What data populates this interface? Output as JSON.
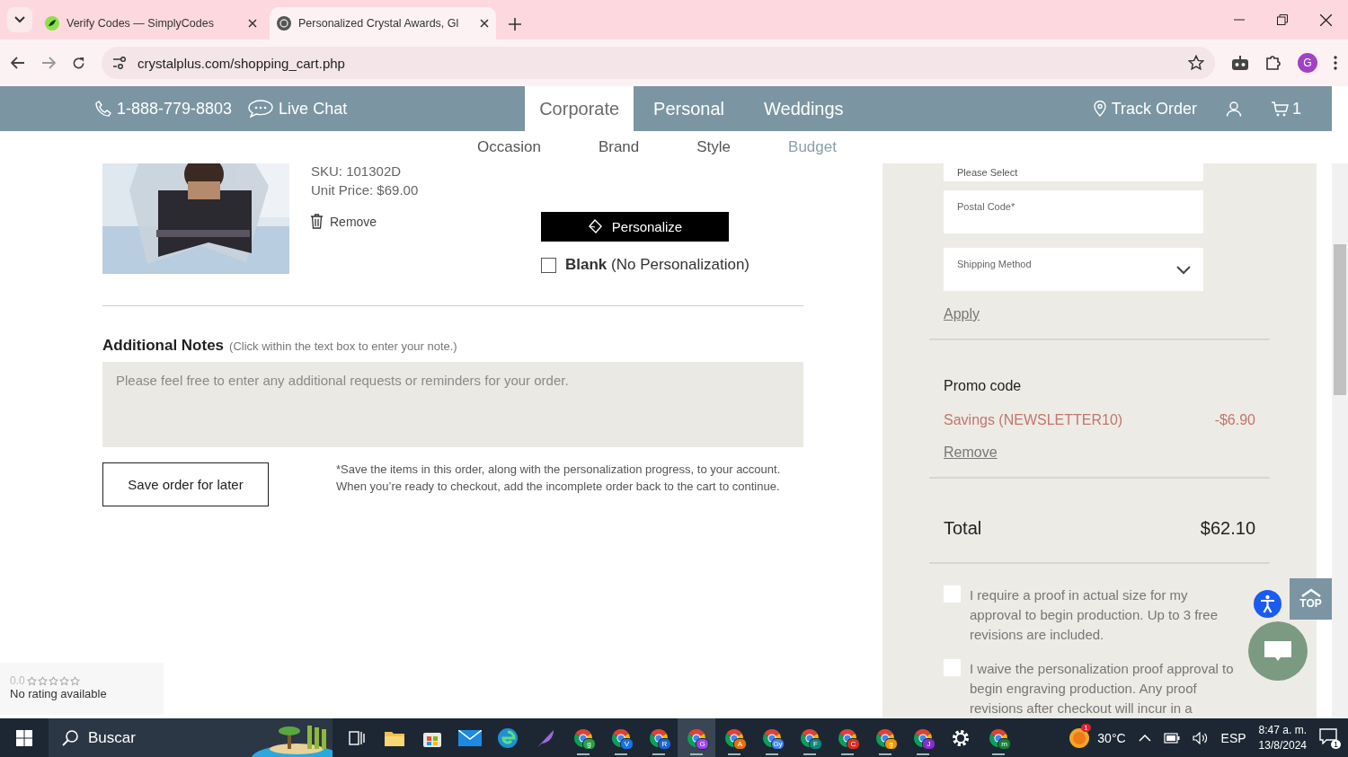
{
  "browser": {
    "tabs": [
      {
        "title": "Verify Codes — SimplyCodes",
        "selected": false
      },
      {
        "title": "Personalized Crystal Awards, Gl",
        "selected": true
      }
    ],
    "url": "crystalplus.com/shopping_cart.php",
    "profile": "G"
  },
  "header": {
    "phone": "1-888-779-8803",
    "chat": "Live Chat",
    "nav": [
      {
        "label": "Corporate",
        "selected": true
      },
      {
        "label": "Personal",
        "selected": false
      },
      {
        "label": "Weddings",
        "selected": false
      }
    ],
    "track": "Track Order",
    "cart_count": "1"
  },
  "subnav": [
    {
      "label": "Occasion",
      "selected": false
    },
    {
      "label": "Brand",
      "selected": false
    },
    {
      "label": "Style",
      "selected": false
    },
    {
      "label": "Budget",
      "selected": true
    }
  ],
  "item": {
    "sku": "SKU: 101302D",
    "unit_price": "Unit Price: $69.00",
    "remove": "Remove",
    "personalize": "Personalize",
    "blank": {
      "label": "**Blank** (No Personalization)",
      "checked": false
    }
  },
  "notes": {
    "title": "Additional Notes",
    "hint": "(Click within the text box to enter your note.)",
    "placeholder": "Please feel free to enter any additional requests or reminders for your order."
  },
  "save_button": "Save order for later",
  "save_note": "*Save the items in this order, along with the personalization progress, to your account. When you’re ready to checkout, add the incomplete order back to the cart to continue.",
  "summary": {
    "fields": [
      {
        "kind": "select",
        "value": "Please Select"
      },
      {
        "kind": "text",
        "label": "Postal Code*"
      },
      {
        "kind": "select",
        "label": "Shipping Method"
      }
    ],
    "apply": "Apply",
    "promo_title": "Promo code",
    "savings_label": "Savings (NEWSLETTER10)",
    "savings_amount": "-$6.90",
    "promo_remove": "Remove",
    "total_label": "Total",
    "total": "$62.10",
    "proofs": [
      {
        "text": "I require a proof in actual size for my approval to begin production. Up to 3 free revisions are included.",
        "checked": false
      },
      {
        "text": "I waive the personalization proof approval to begin engraving production. Any proof revisions after checkout will incur in a",
        "checked": false
      }
    ]
  },
  "rating": {
    "score": "0.0",
    "stars": 0,
    "text": "No rating available"
  },
  "top_button": "TOP",
  "taskbar": {
    "search": "Buscar",
    "apps": [
      {
        "kind": "taskview",
        "selected": false
      },
      {
        "kind": "folder",
        "selected": false
      },
      {
        "kind": "store",
        "selected": false
      },
      {
        "kind": "mail",
        "selected": false
      },
      {
        "kind": "edge",
        "selected": false
      },
      {
        "kind": "feather",
        "selected": false
      },
      {
        "kind": "chrome",
        "badge": "g",
        "color": "#2e9e4f",
        "selected": false
      },
      {
        "kind": "chrome",
        "badge": "V",
        "color": "#1a73e8",
        "selected": false
      },
      {
        "kind": "chrome",
        "badge": "R",
        "color": "#1967d2",
        "selected": false
      },
      {
        "kind": "chrome",
        "badge": "G",
        "color": "#a142f4",
        "selected": true
      },
      {
        "kind": "chrome",
        "badge": "A",
        "color": "#e8710a",
        "selected": false
      },
      {
        "kind": "chrome",
        "badge": "Gy",
        "color": "#4285f4",
        "selected": false
      },
      {
        "kind": "chrome",
        "badge": "F",
        "color": "#12857c",
        "selected": false
      },
      {
        "kind": "chrome",
        "badge": "C",
        "color": "#d93025",
        "selected": false
      },
      {
        "kind": "chrome",
        "badge": "g",
        "color": "#f29900",
        "selected": false
      },
      {
        "kind": "chrome",
        "badge": "J",
        "color": "#8430ce",
        "selected": false
      },
      {
        "kind": "settings",
        "selected": false
      },
      {
        "kind": "chrome",
        "badge": "m",
        "color": "#188038",
        "selected": false
      }
    ],
    "weather": "30°C",
    "weather_badge": "1",
    "language": "ESP",
    "time": "8:47 a. m.",
    "date": "13/8/2024",
    "notifications": "1"
  }
}
